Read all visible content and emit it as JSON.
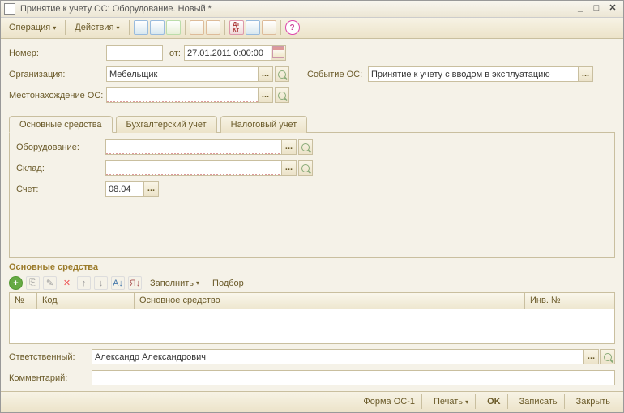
{
  "window": {
    "title": "Принятие к учету ОС: Оборудование. Новый *"
  },
  "menubar": {
    "operation": "Операция",
    "actions": "Действия"
  },
  "fields": {
    "number_label": "Номер:",
    "number_value": "",
    "date_from_label": "от:",
    "date_value": "27.01.2011 0:00:00",
    "org_label": "Организация:",
    "org_value": "Мебельщик",
    "event_label": "Событие ОС:",
    "event_value": "Принятие к учету с вводом в эксплуатацию",
    "location_label": "Местонахождение ОС:",
    "location_value": ""
  },
  "tabs": {
    "t1": "Основные средства",
    "t2": "Бухгалтерский учет",
    "t3": "Налоговый учет"
  },
  "tab1": {
    "equipment_label": "Оборудование:",
    "equipment_value": "",
    "warehouse_label": "Склад:",
    "warehouse_value": "",
    "account_label": "Счет:",
    "account_value": "08.04"
  },
  "section": {
    "title": "Основные средства",
    "fill": "Заполнить",
    "select": "Подбор"
  },
  "grid": {
    "col_num": "№",
    "col_code": "Код",
    "col_asset": "Основное средство",
    "col_inv": "Инв. №"
  },
  "bottom": {
    "responsible_label": "Ответственный:",
    "responsible_value": "Александр Александрович",
    "comment_label": "Комментарий:",
    "comment_value": ""
  },
  "footer": {
    "form": "Форма ОС-1",
    "print": "Печать",
    "ok": "OK",
    "save": "Записать",
    "close": "Закрыть"
  }
}
